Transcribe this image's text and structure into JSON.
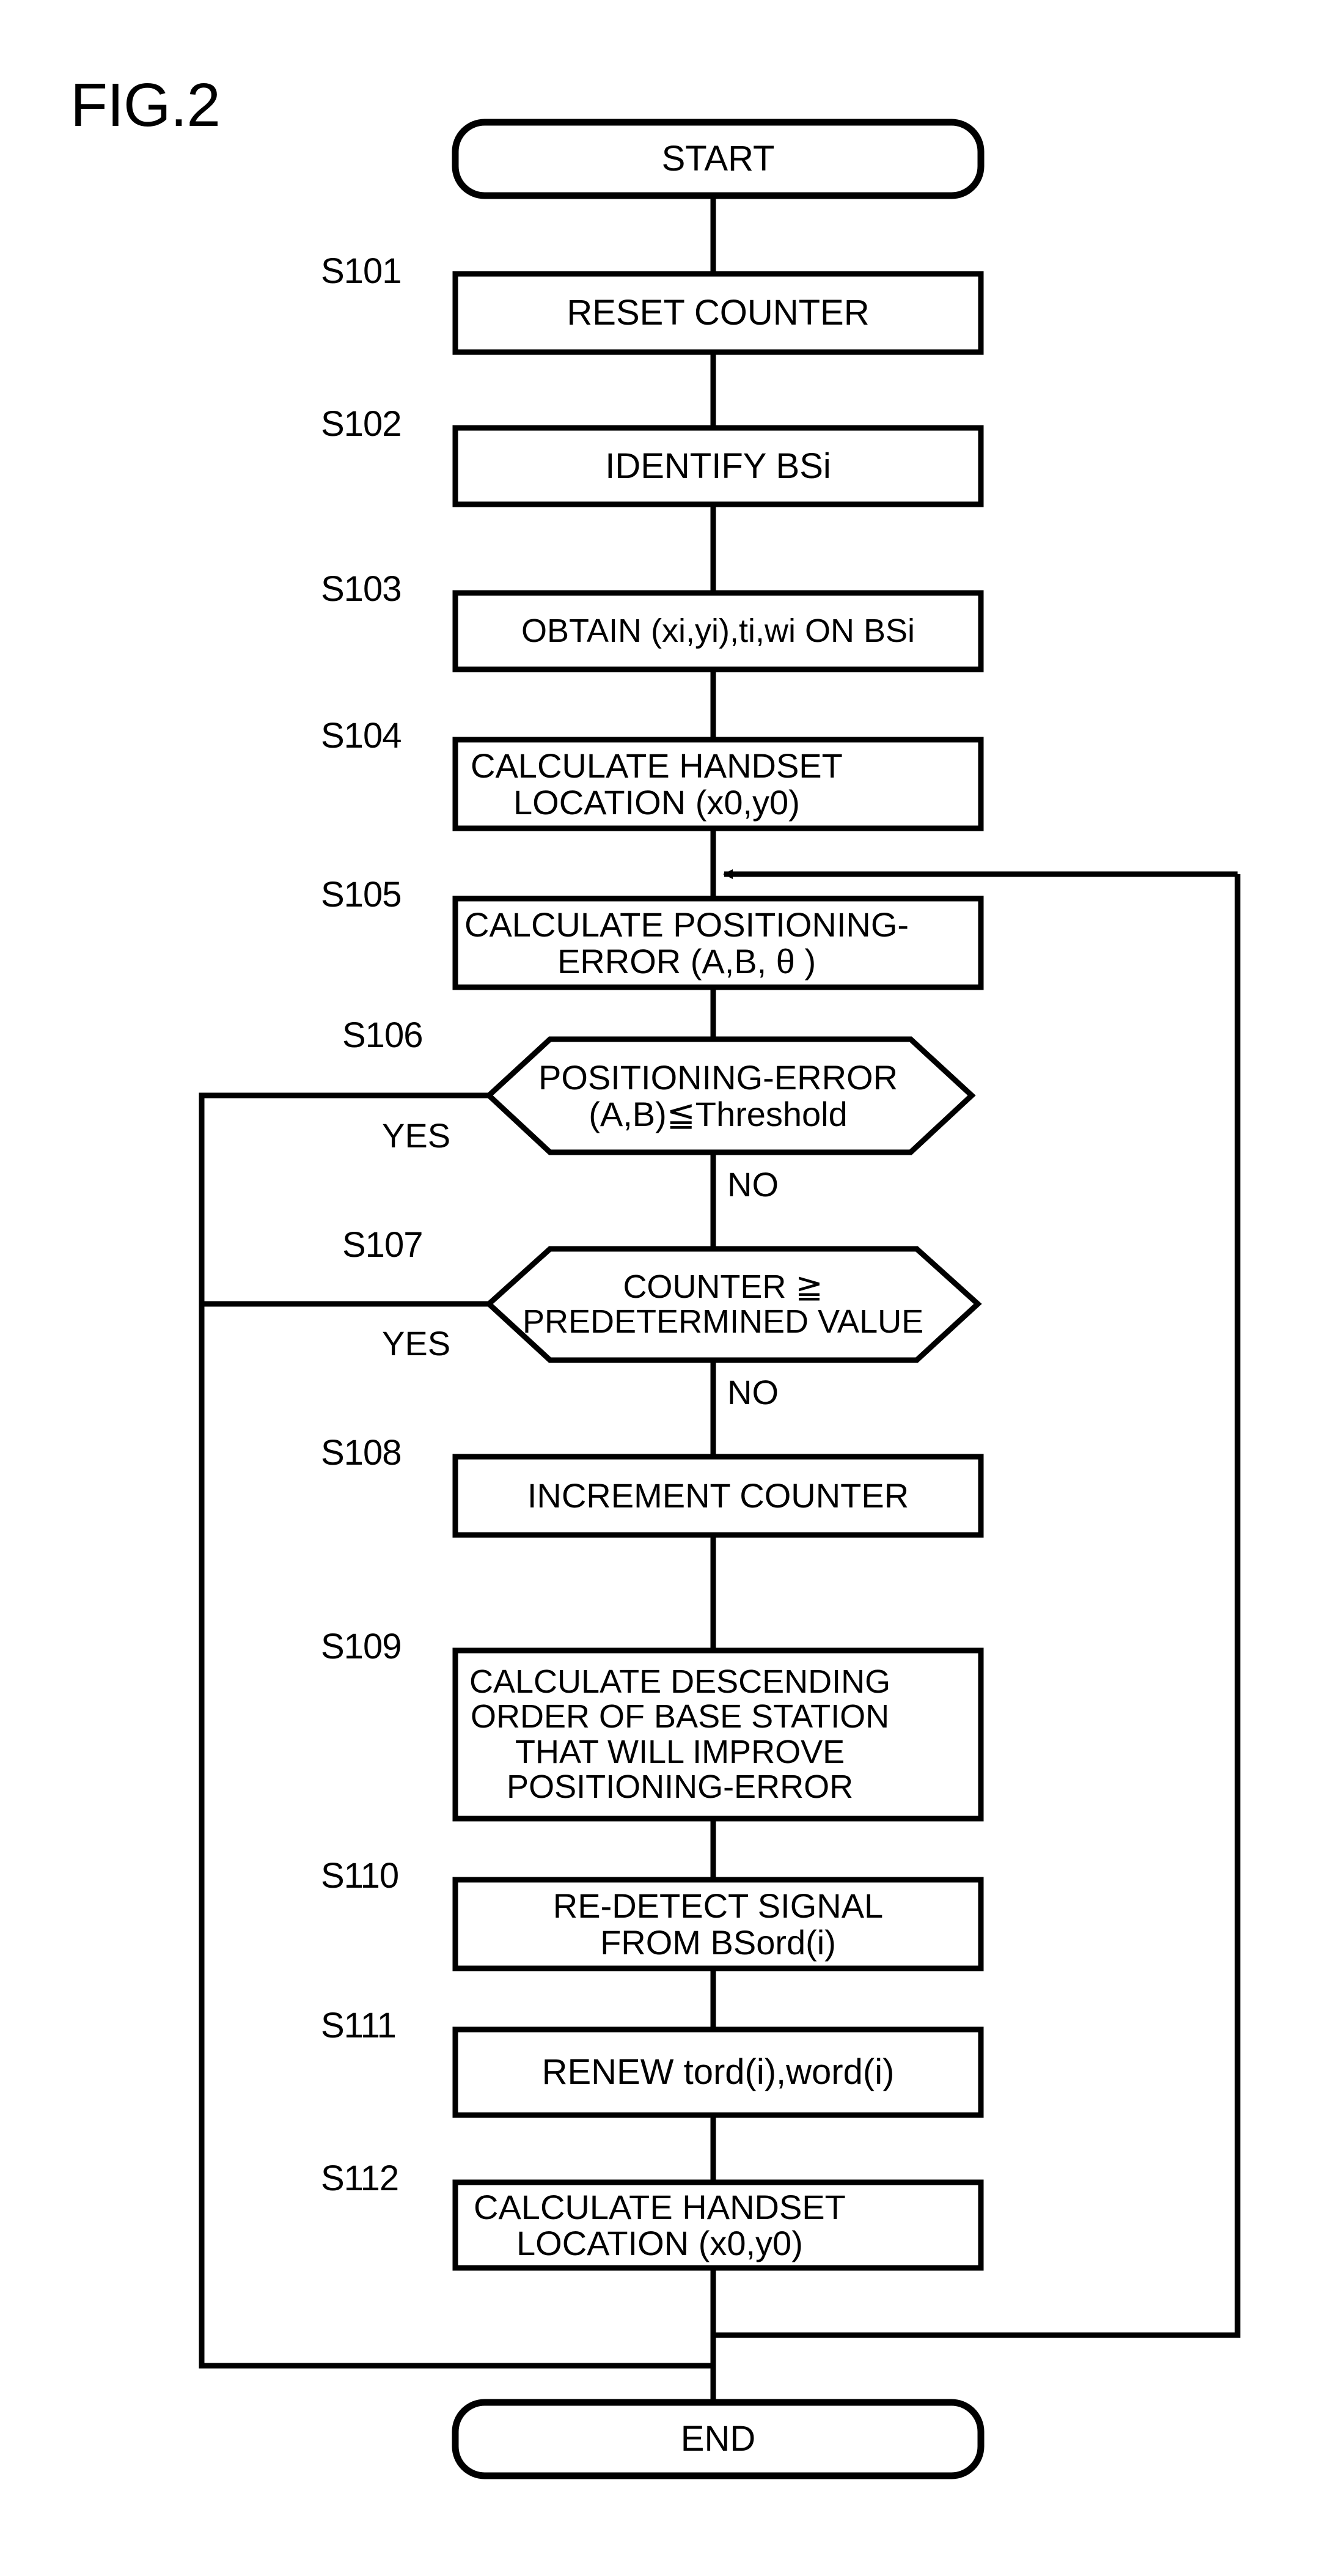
{
  "figure": {
    "title": "FIG.2",
    "type": "flowchart"
  },
  "nodes": {
    "start": {
      "label": "START",
      "shape": "rounded-terminator"
    },
    "s101": {
      "step": "S101",
      "label": "RESET COUNTER",
      "shape": "process"
    },
    "s102": {
      "step": "S102",
      "label": "IDENTIFY  BSi",
      "shape": "process"
    },
    "s103": {
      "step": "S103",
      "label": "OBTAIN (xi,yi),ti,wi ON BSi",
      "shape": "process"
    },
    "s104": {
      "step": "S104",
      "label": "CALCULATE HANDSET\nLOCATION (x0,y0)",
      "shape": "process"
    },
    "s105": {
      "step": "S105",
      "label": "CALCULATE POSITIONING-\nERROR (A,B, θ )",
      "shape": "process"
    },
    "s106": {
      "step": "S106",
      "label": "POSITIONING-ERROR\n(A,B)≦Threshold",
      "shape": "decision-hexagon"
    },
    "s107": {
      "step": "S107",
      "label": "COUNTER ≧\nPREDETERMINED VALUE",
      "shape": "decision-hexagon"
    },
    "s108": {
      "step": "S108",
      "label": "INCREMENT COUNTER",
      "shape": "process"
    },
    "s109": {
      "step": "S109",
      "label": "CALCULATE DESCENDING\nORDER OF BASE STATION\nTHAT WILL IMPROVE\nPOSITIONING-ERROR",
      "shape": "process"
    },
    "s110": {
      "step": "S110",
      "label": "RE-DETECT SIGNAL\nFROM BSord(i)",
      "shape": "process"
    },
    "s111": {
      "step": "S111",
      "label": "RENEW tord(i),word(i)",
      "shape": "process"
    },
    "s112": {
      "step": "S112",
      "label": "CALCULATE HANDSET\nLOCATION (x0,y0)",
      "shape": "process"
    },
    "end": {
      "label": "END",
      "shape": "rounded-terminator"
    }
  },
  "branch_labels": {
    "s106_yes": "YES",
    "s106_no": "NO",
    "s107_yes": "YES",
    "s107_no": "NO"
  },
  "colors": {
    "stroke": "#000000",
    "fill": "#ffffff",
    "background": "#ffffff"
  }
}
